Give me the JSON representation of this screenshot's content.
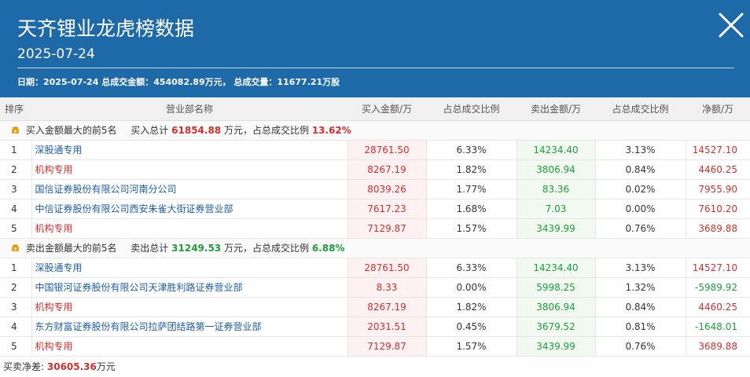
{
  "header": {
    "title": "天齐锂业龙虎榜数据",
    "date": "2025-07-24",
    "summary": "日期：2025-07-24 总成交金额：454082.89万元， 总成交量：11677.21万股"
  },
  "columns": [
    "排序",
    "营业部名称",
    "买入金额/万",
    "占总成交比例",
    "卖出金额/万",
    "占总成交比例",
    "净额/万"
  ],
  "buy_section": {
    "label": "买入金额最大的前5名",
    "total_prefix": "买入总计",
    "total_value": "61854.88",
    "total_unit": "万元，占总成交比例",
    "ratio": "13.62%",
    "rows": [
      {
        "rank": "1",
        "name": "深股通专用",
        "buy": "28761.50",
        "buy_pct": "6.33%",
        "sell": "14234.40",
        "sell_pct": "3.13%",
        "net": "14527.10",
        "net_color": "red"
      },
      {
        "rank": "2",
        "name": "机构专用",
        "buy": "8267.19",
        "buy_pct": "1.82%",
        "sell": "3806.94",
        "sell_pct": "0.84%",
        "net": "4460.25",
        "net_color": "red"
      },
      {
        "rank": "3",
        "name": "国信证券股份有限公司河南分公司",
        "buy": "8039.26",
        "buy_pct": "1.77%",
        "sell": "83.36",
        "sell_pct": "0.02%",
        "net": "7955.90",
        "net_color": "red"
      },
      {
        "rank": "4",
        "name": "中信证券股份有限公司西安朱雀大街证券营业部",
        "buy": "7617.23",
        "buy_pct": "1.68%",
        "sell": "7.03",
        "sell_pct": "0.00%",
        "net": "7610.20",
        "net_color": "red"
      },
      {
        "rank": "5",
        "name": "机构专用",
        "buy": "7129.87",
        "buy_pct": "1.57%",
        "sell": "3439.99",
        "sell_pct": "0.76%",
        "net": "3689.88",
        "net_color": "red"
      }
    ]
  },
  "sell_section": {
    "label": "卖出金额最大的前5名",
    "total_prefix": "卖出总计",
    "total_value": "31249.53",
    "total_unit": "万元，占总成交比例",
    "ratio": "6.88%",
    "rows": [
      {
        "rank": "1",
        "name": "深股通专用",
        "buy": "28761.50",
        "buy_pct": "6.33%",
        "sell": "14234.40",
        "sell_pct": "3.13%",
        "net": "14527.10",
        "net_color": "red"
      },
      {
        "rank": "2",
        "name": "中国银河证券股份有限公司天津胜利路证券营业部",
        "buy": "8.33",
        "buy_pct": "0.00%",
        "sell": "5998.25",
        "sell_pct": "1.32%",
        "net": "-5989.92",
        "net_color": "green"
      },
      {
        "rank": "3",
        "name": "机构专用",
        "buy": "8267.19",
        "buy_pct": "1.82%",
        "sell": "3806.94",
        "sell_pct": "0.84%",
        "net": "4460.25",
        "net_color": "red"
      },
      {
        "rank": "4",
        "name": "东方财富证券股份有限公司拉萨团结路第一证券营业部",
        "buy": "2031.51",
        "buy_pct": "0.45%",
        "sell": "3679.52",
        "sell_pct": "0.81%",
        "net": "-1648.01",
        "net_color": "green"
      },
      {
        "rank": "5",
        "name": "机构专用",
        "buy": "7129.87",
        "buy_pct": "1.57%",
        "sell": "3439.99",
        "sell_pct": "0.76%",
        "net": "3689.88",
        "net_color": "red"
      }
    ]
  },
  "footer": {
    "label": "买卖净差:",
    "value": "30605.36",
    "unit": "万元"
  },
  "colors": {
    "header_bg": "#1e69a8",
    "red": "#d32f2f",
    "green": "#1e9e3c",
    "link_blue": "#1e5da8"
  }
}
